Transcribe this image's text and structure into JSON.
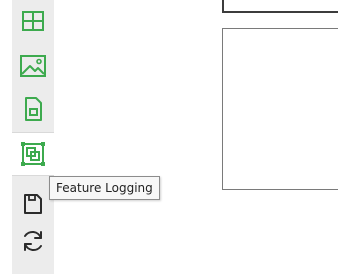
{
  "toolbar": {
    "items": [
      {
        "name": "grid-icon",
        "active": false
      },
      {
        "name": "image-icon",
        "active": false
      },
      {
        "name": "document-icon",
        "active": false
      },
      {
        "name": "feature-logging-icon",
        "active": true
      },
      {
        "name": "save-icon",
        "active": false
      },
      {
        "name": "refresh-icon",
        "active": false
      }
    ]
  },
  "tooltip": {
    "text": "Feature Logging"
  },
  "colors": {
    "accent": "#3daa4e",
    "icon_dark": "#2b2b2b",
    "toolbar_bg": "#ececec",
    "tooltip_bg": "#f7f7f7"
  }
}
